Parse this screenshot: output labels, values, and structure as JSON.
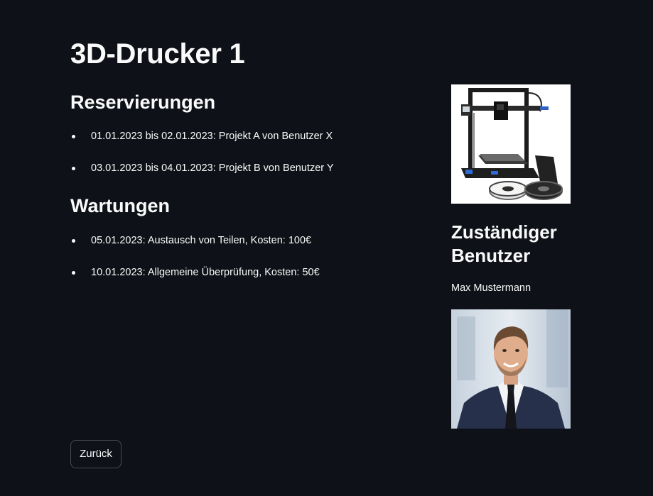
{
  "page": {
    "title": "3D-Drucker 1"
  },
  "reservations": {
    "heading": "Reservierungen",
    "items": [
      "01.01.2023 bis 02.01.2023: Projekt A von Benutzer X",
      "03.01.2023 bis 04.01.2023: Projekt B von Benutzer Y"
    ]
  },
  "maintenance": {
    "heading": "Wartungen",
    "items": [
      "05.01.2023: Austausch von Teilen, Kosten: 100€",
      "10.01.2023: Allgemeine Überprüfung, Kosten: 50€"
    ]
  },
  "assignee": {
    "heading": "Zuständiger Benutzer",
    "name": "Max Mustermann"
  },
  "actions": {
    "back_label": "Zurück"
  },
  "colors": {
    "background": "#0e1117",
    "text": "#fafafa"
  }
}
